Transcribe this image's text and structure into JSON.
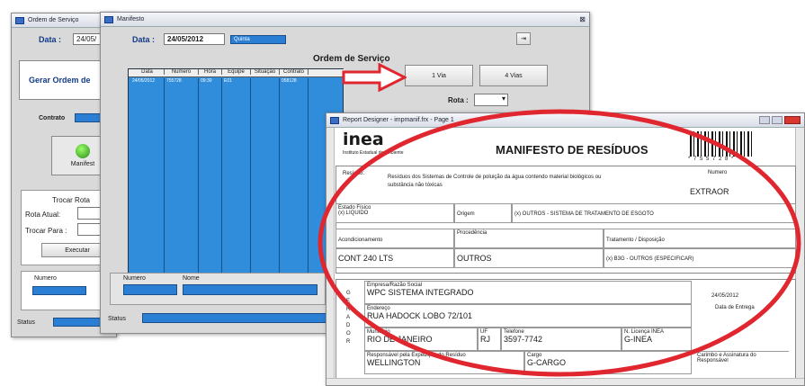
{
  "w1": {
    "title": "Ordem de Serviço",
    "data_label": "Data :",
    "data_value": "24/05/",
    "gerar": "Gerar Ordem de",
    "contrato": "Contrato",
    "manifest": "Manifest",
    "trocar": "Trocar Rota",
    "rota_atual": "Rota Atual:",
    "trocar_para": "Trocar Para :",
    "executar": "Executar",
    "numero": "Numero",
    "n": "N",
    "status": "Status"
  },
  "w2": {
    "title": "Manifesto",
    "data_label": "Data :",
    "data_value": "24/05/2012",
    "day": "Quinta",
    "heading": "Ordem de Serviço",
    "cols": [
      "Data",
      "Numero",
      "Hora",
      "Equipe",
      "Situação",
      "Contrato"
    ],
    "row": [
      "24/05/2012",
      "755728",
      "09:30",
      "E01",
      "",
      "058128"
    ],
    "btn1": "1 Via",
    "btn4": "4 Vias",
    "rota": "Rota :",
    "numero": "Numero",
    "nome": "Nome",
    "status": "Status"
  },
  "w3": {
    "title": "Report Designer - impmanif.frx - Page 1",
    "logo": "inea",
    "logo_sub": "Instituto Estadual do Ambiente",
    "heading": "MANIFESTO DE RESÍDUOS",
    "barcode_text": "* 7 5 5 7 2 8 *",
    "residuo_label": "Resíduo:",
    "residuo_text1": "Resíduos dos Sistemas de Controle de poluição da água contendo material biológicos ou",
    "residuo_text2": "substância não tóxicas",
    "numero_label": "Numero",
    "extrator": "EXTRAOR",
    "estado_label": "Estado Físico",
    "estado_value": "(x) LIQUIDO",
    "origem_label": "Origem",
    "origem_value": "(x) OUTROS - SISTEMA DE TRATAMENTO DE ESGOTO",
    "acond_label": "Acondicionamento",
    "proced_label": "Procedência",
    "trat_label": "Tratamento / Disposição",
    "acond_value": "CONT 240 LTS",
    "proced_value": "OUTROS",
    "trat_value": "(x) B3G - OUTROS (ESPECIFICAR)",
    "gerador": [
      "G",
      "E",
      "R",
      "A",
      "D",
      "O",
      "R"
    ],
    "empresa_label": "Empresa/Razão Social",
    "empresa_value": "WPC SISTEMA INTEGRADO",
    "endereco_label": "Endereço",
    "endereco_value": "RUA HADOCK LOBO 72/101",
    "municipio_label": "Município",
    "municipio_value": "RIO DE JANEIRO",
    "uf_label": "UF",
    "uf_value": "RJ",
    "tel_label": "Telefone",
    "tel_value": "3597-7742",
    "lic_label": "N. Licença INEA",
    "lic_value": "G-INEA",
    "resp_label": "Responsável pela Expedição do Resíduo",
    "resp_value": "WELLINGTON",
    "cargo_label": "Cargo",
    "cargo_value": "G-CARGO",
    "date_value": "24/05/2012",
    "date_label": "Data de Entrega",
    "carimbo": "Carimbo e Assinatura do Responsável"
  },
  "colors": {
    "blue": "#2a7fd4",
    "red": "#e0262f"
  }
}
